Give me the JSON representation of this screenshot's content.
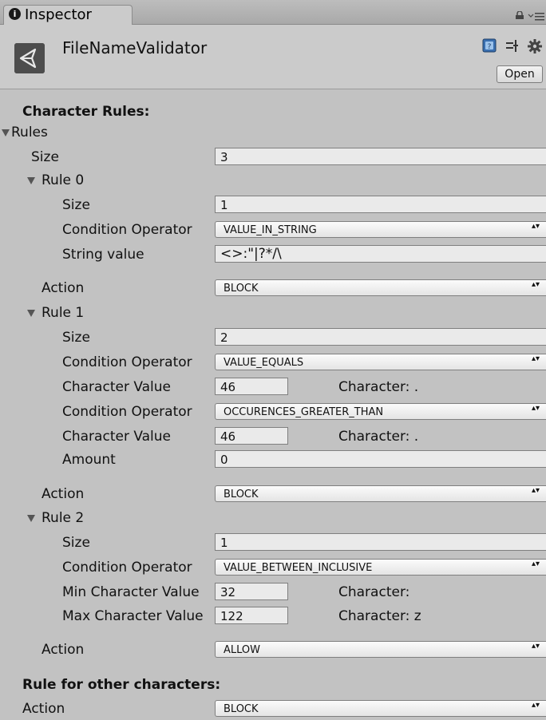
{
  "tab": {
    "label": "Inspector",
    "info_glyph": "i"
  },
  "header": {
    "component_name": "FileNameValidator",
    "open_label": "Open"
  },
  "sections": {
    "character_rules": "Character Rules:",
    "other_rule": "Rule for other characters:"
  },
  "rules": {
    "foldout_label": "Rules",
    "size_label": "Size",
    "size_value": "3",
    "rule0": {
      "foldout_label": "Rule 0",
      "size_label": "Size",
      "size_value": "1",
      "condition_label": "Condition Operator",
      "condition_value": "VALUE_IN_STRING",
      "string_label": "String value",
      "string_value": "<>:\"|?*/\\",
      "action_label": "Action",
      "action_value": "BLOCK"
    },
    "rule1": {
      "foldout_label": "Rule 1",
      "size_label": "Size",
      "size_value": "2",
      "condition1_label": "Condition Operator",
      "condition1_value": "VALUE_EQUALS",
      "charvalue1_label": "Character Value",
      "charvalue1_value": "46",
      "char1_info": "Character: .",
      "condition2_label": "Condition Operator",
      "condition2_value": "OCCURENCES_GREATER_THAN",
      "charvalue2_label": "Character Value",
      "charvalue2_value": "46",
      "char2_info": "Character: .",
      "amount_label": "Amount",
      "amount_value": "0",
      "action_label": "Action",
      "action_value": "BLOCK"
    },
    "rule2": {
      "foldout_label": "Rule 2",
      "size_label": "Size",
      "size_value": "1",
      "condition_label": "Condition Operator",
      "condition_value": "VALUE_BETWEEN_INCLUSIVE",
      "min_label": "Min Character Value",
      "min_value": "32",
      "min_info": "Character:",
      "max_label": "Max Character Value",
      "max_value": "122",
      "max_info": "Character: z",
      "action_label": "Action",
      "action_value": "ALLOW"
    }
  },
  "other": {
    "action_label": "Action",
    "action_value": "BLOCK"
  },
  "dropdown_arrow": "▴▾",
  "icons": [
    "info-icon",
    "lock-icon",
    "tab-menu-icon",
    "unity-script-icon",
    "help-icon",
    "preset-icon",
    "gear-icon",
    "foldout-arrow-icon",
    "dropdown-arrow-icon"
  ]
}
